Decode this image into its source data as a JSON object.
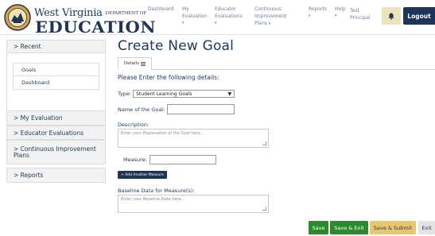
{
  "header": {
    "logo": {
      "line1": "West Virginia",
      "line1_suffix": "DEPARTMENT OF",
      "line2": "EDUCATION"
    },
    "nav": [
      {
        "label": "Dashboard",
        "has_dropdown": false
      },
      {
        "label": "My Evaluation",
        "has_dropdown": true
      },
      {
        "label": "Educator Evaluations",
        "has_dropdown": true
      },
      {
        "label": "Continuous Improvement Plans",
        "has_dropdown": true
      },
      {
        "label": "Reports",
        "has_dropdown": true
      },
      {
        "label": "Help",
        "has_dropdown": true
      }
    ],
    "user": "Test Principal",
    "logout_label": "Logout",
    "icons": {
      "notifications": "bell-icon"
    }
  },
  "sidebar": {
    "recent_label": "> Recent",
    "recent_links": [
      "Goals",
      "Dashboard"
    ],
    "items": [
      {
        "label": "> My Evaluation"
      },
      {
        "label": "> Educator Evaluations"
      },
      {
        "label": "> Continuous Improvement Plans"
      },
      {
        "label": "> Reports"
      }
    ]
  },
  "main": {
    "title": "Create New Goal",
    "tab_label": "Details",
    "instructions": "Please Enter the following details:",
    "type_label": "Type:",
    "type_value": "Student Learning Goals",
    "name_label": "Name of the Goal:",
    "name_value": "",
    "description_label": "Description:",
    "description_placeholder": "Enter your Explanation of the Goal here...",
    "measure_label": "Measure:",
    "measure_value": "",
    "add_measure_label": "+ Add Another Measure",
    "baseline_label": "Baseline Data for Measure(s):",
    "baseline_placeholder": "Enter your Baseline Data here..."
  },
  "actions": {
    "save": "Save",
    "save_exit": "Save & Exit",
    "save_submit": "Save & Submit",
    "exit": "Exit"
  },
  "colors": {
    "brand_navy": "#1f3558",
    "save_green": "#2c8a2e",
    "submit_gold": "#e8c56e",
    "bell_bg": "#ebe3bc"
  }
}
